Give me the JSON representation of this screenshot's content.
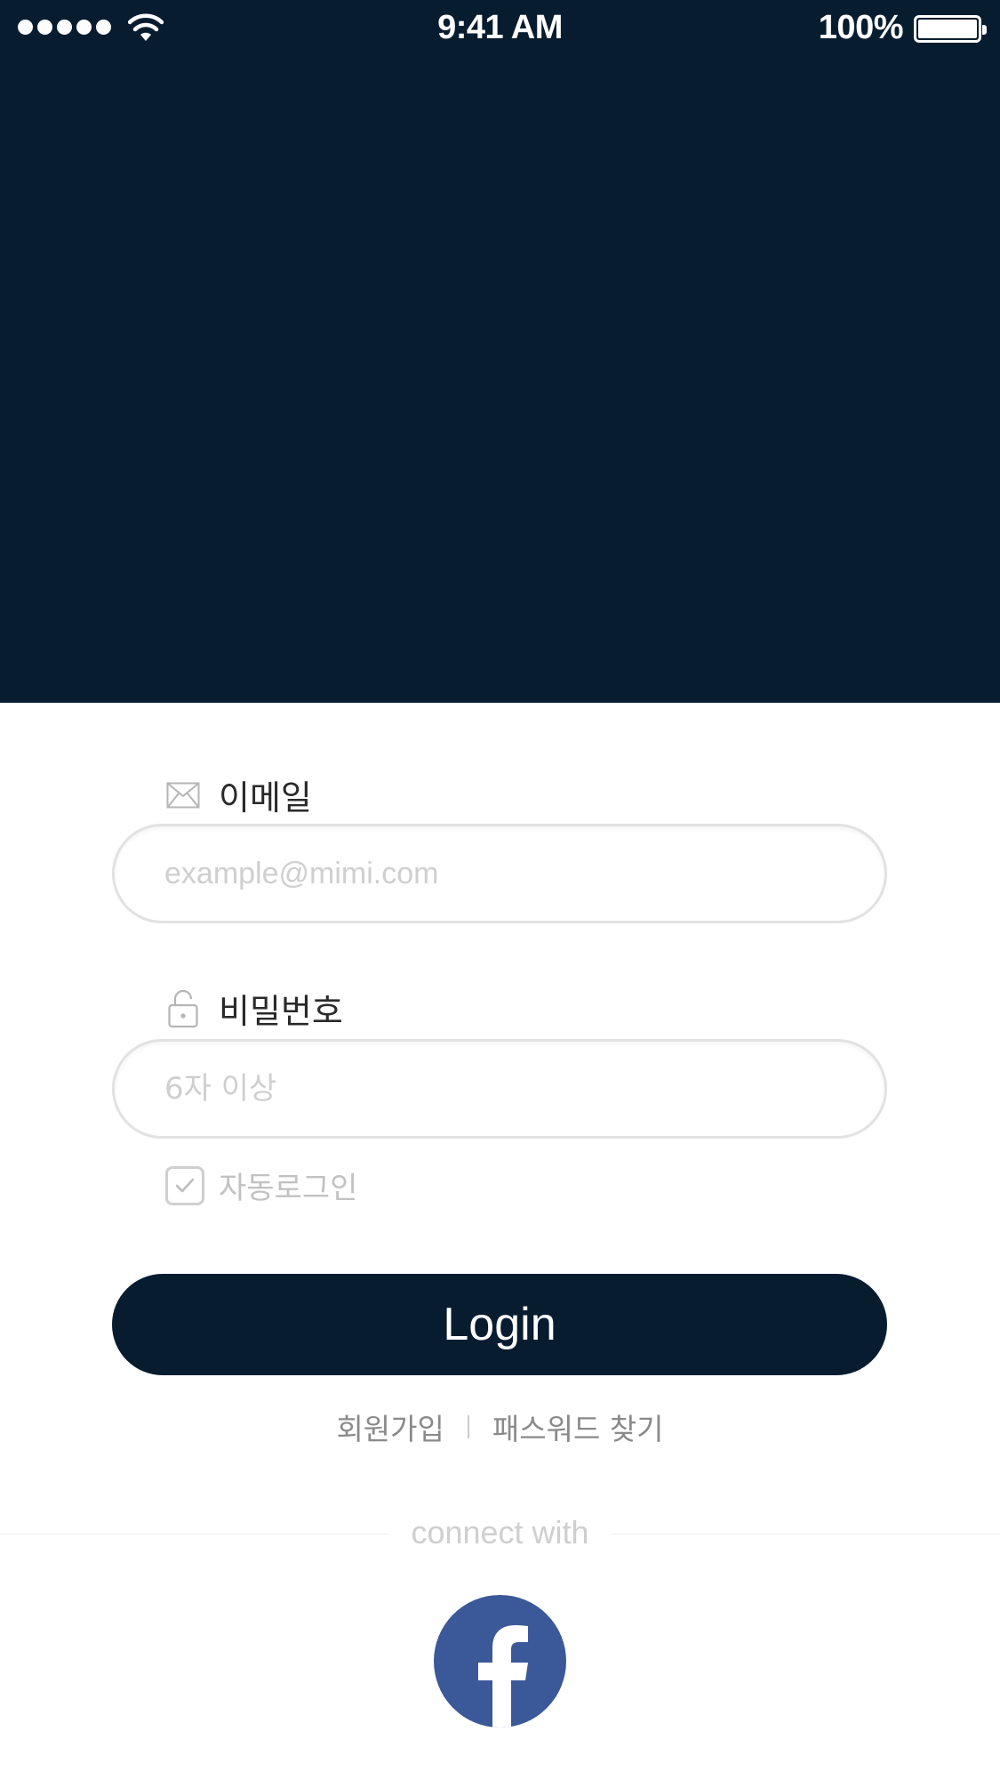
{
  "status_bar": {
    "time": "9:41 AM",
    "battery_percent": "100%"
  },
  "form": {
    "email": {
      "label": "이메일",
      "placeholder": "example@mimi.com",
      "icon": "envelope-icon"
    },
    "password": {
      "label": "비밀번호",
      "placeholder": "6자 이상",
      "icon": "unlock-icon"
    },
    "auto_login": {
      "label": "자동로그인",
      "checked": true
    },
    "login_button": "Login"
  },
  "links": {
    "signup": "회원가입",
    "find_password": "패스워드 찾기"
  },
  "social": {
    "connect_label": "connect with",
    "facebook_icon": "facebook-icon"
  },
  "colors": {
    "primary": "#081c30",
    "facebook": "#3b5998"
  }
}
